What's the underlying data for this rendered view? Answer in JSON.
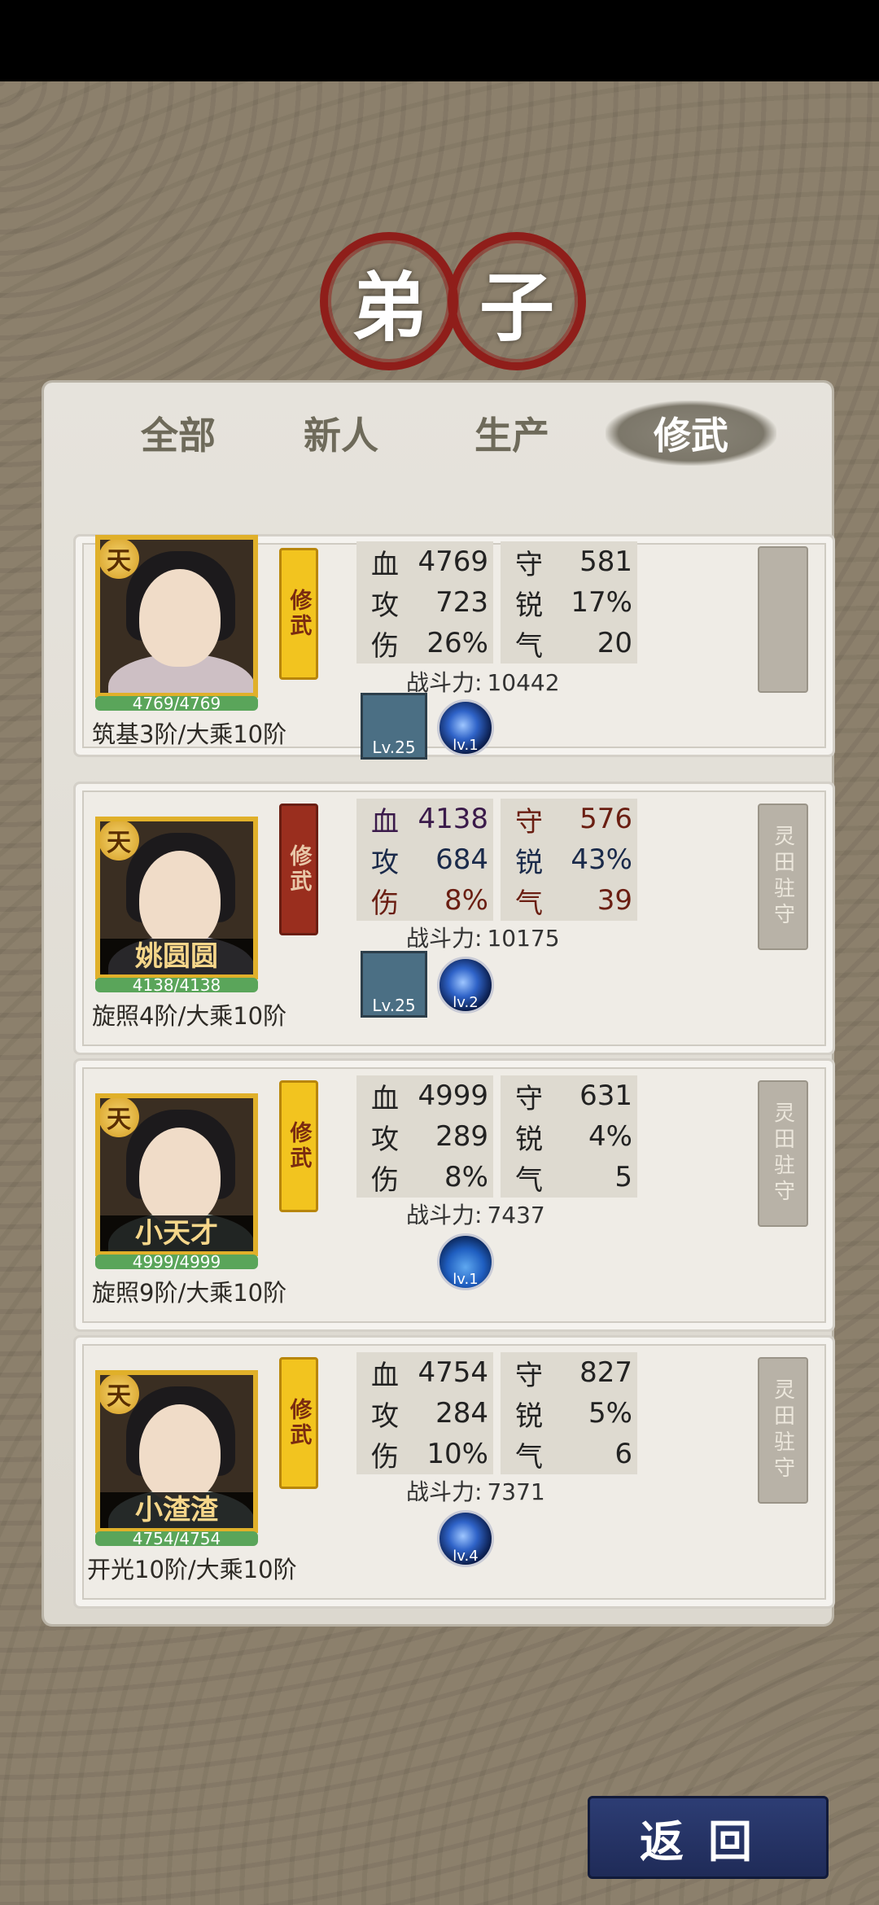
{
  "title": {
    "char1": "弟",
    "char2": "子"
  },
  "tabs": [
    {
      "label": "全部"
    },
    {
      "label": "新人"
    },
    {
      "label": "生产"
    },
    {
      "label": "修武"
    }
  ],
  "labels": {
    "hp": "血",
    "def": "守",
    "atk": "攻",
    "sharp": "锐",
    "dmg": "伤",
    "qi": "气",
    "power": "战斗力:"
  },
  "disciples": [
    {
      "name": "",
      "grade": "天",
      "hp_text": "4769/4769",
      "realm": "筑基3阶/大乘10阶",
      "tag": "修武",
      "hp": "4769",
      "def": "581",
      "atk": "723",
      "sharp": "17%",
      "dmg": "26%",
      "qi": "20",
      "power": "10442",
      "equip_level": "Lv.25",
      "skill_level": "lv.1",
      "station": ""
    },
    {
      "name": "姚圆圆",
      "grade": "天",
      "hp_text": "4138/4138",
      "realm": "旋照4阶/大乘10阶",
      "tag": "修武",
      "hp": "4138",
      "def": "576",
      "atk": "684",
      "sharp": "43%",
      "dmg": "8%",
      "qi": "39",
      "power": "10175",
      "equip_level": "Lv.25",
      "skill_level": "lv.2",
      "station": "灵田驻守"
    },
    {
      "name": "小天才",
      "grade": "天",
      "hp_text": "4999/4999",
      "realm": "旋照9阶/大乘10阶",
      "tag": "修武",
      "hp": "4999",
      "def": "631",
      "atk": "289",
      "sharp": "4%",
      "dmg": "8%",
      "qi": "5",
      "power": "7437",
      "skill_level": "lv.1",
      "station": "灵田驻守"
    },
    {
      "name": "小渣渣",
      "grade": "天",
      "hp_text": "4754/4754",
      "realm": "开光10阶/大乘10阶",
      "tag": "修武",
      "hp": "4754",
      "def": "827",
      "atk": "284",
      "sharp": "5%",
      "dmg": "10%",
      "qi": "6",
      "power": "7371",
      "skill_level": "lv.4",
      "station": "灵田驻守"
    }
  ],
  "back_label": "返回"
}
